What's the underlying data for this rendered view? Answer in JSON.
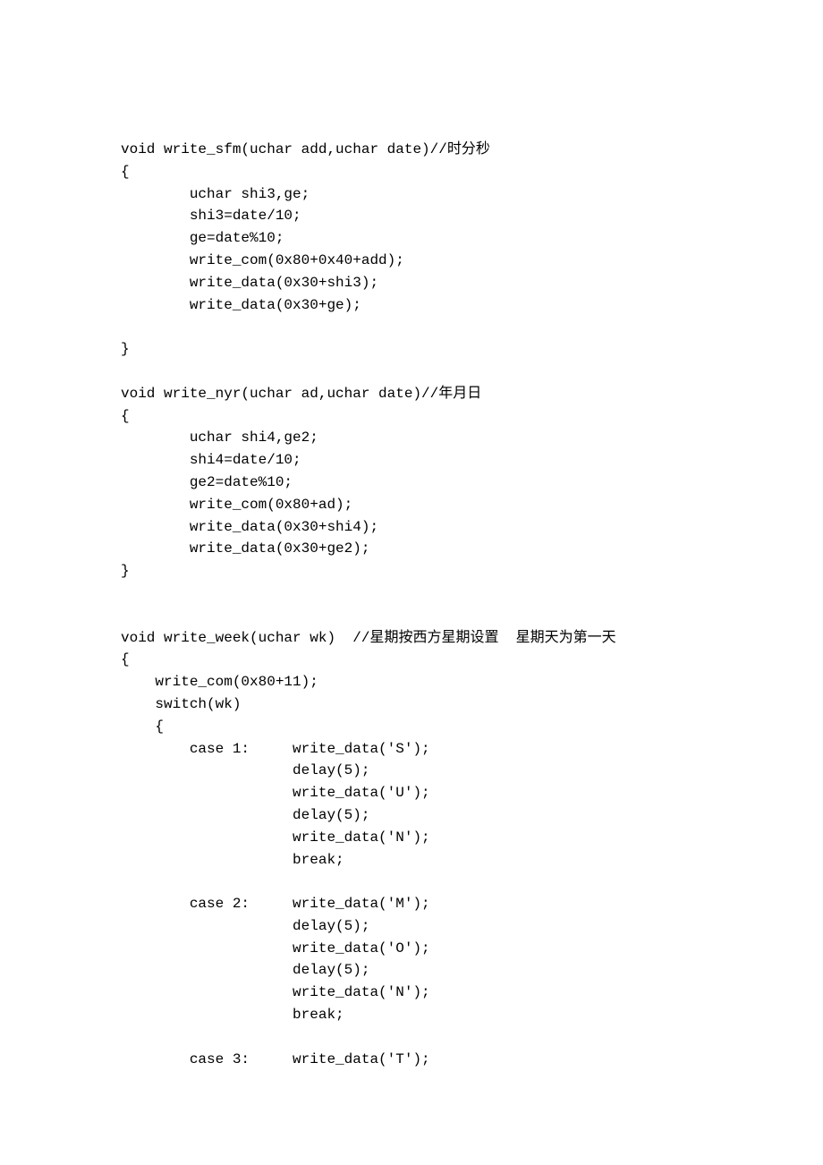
{
  "code": {
    "lines": [
      "void write_sfm(uchar add,uchar date)//时分秒",
      "{",
      "        uchar shi3,ge;",
      "        shi3=date/10;",
      "        ge=date%10;",
      "        write_com(0x80+0x40+add);",
      "        write_data(0x30+shi3);",
      "        write_data(0x30+ge);",
      "",
      "}",
      "",
      "void write_nyr(uchar ad,uchar date)//年月日",
      "{",
      "        uchar shi4,ge2;",
      "        shi4=date/10;",
      "        ge2=date%10;",
      "        write_com(0x80+ad);",
      "        write_data(0x30+shi4);",
      "        write_data(0x30+ge2);",
      "}",
      "",
      "",
      "void write_week(uchar wk)  //星期按西方星期设置  星期天为第一天",
      "{",
      "    write_com(0x80+11);",
      "    switch(wk)",
      "    {",
      "        case 1:     write_data('S');",
      "                    delay(5);",
      "                    write_data('U');",
      "                    delay(5);",
      "                    write_data('N');",
      "                    break;",
      "",
      "        case 2:     write_data('M');",
      "                    delay(5);",
      "                    write_data('O');",
      "                    delay(5);",
      "                    write_data('N');",
      "                    break;",
      "",
      "        case 3:     write_data('T');"
    ]
  }
}
